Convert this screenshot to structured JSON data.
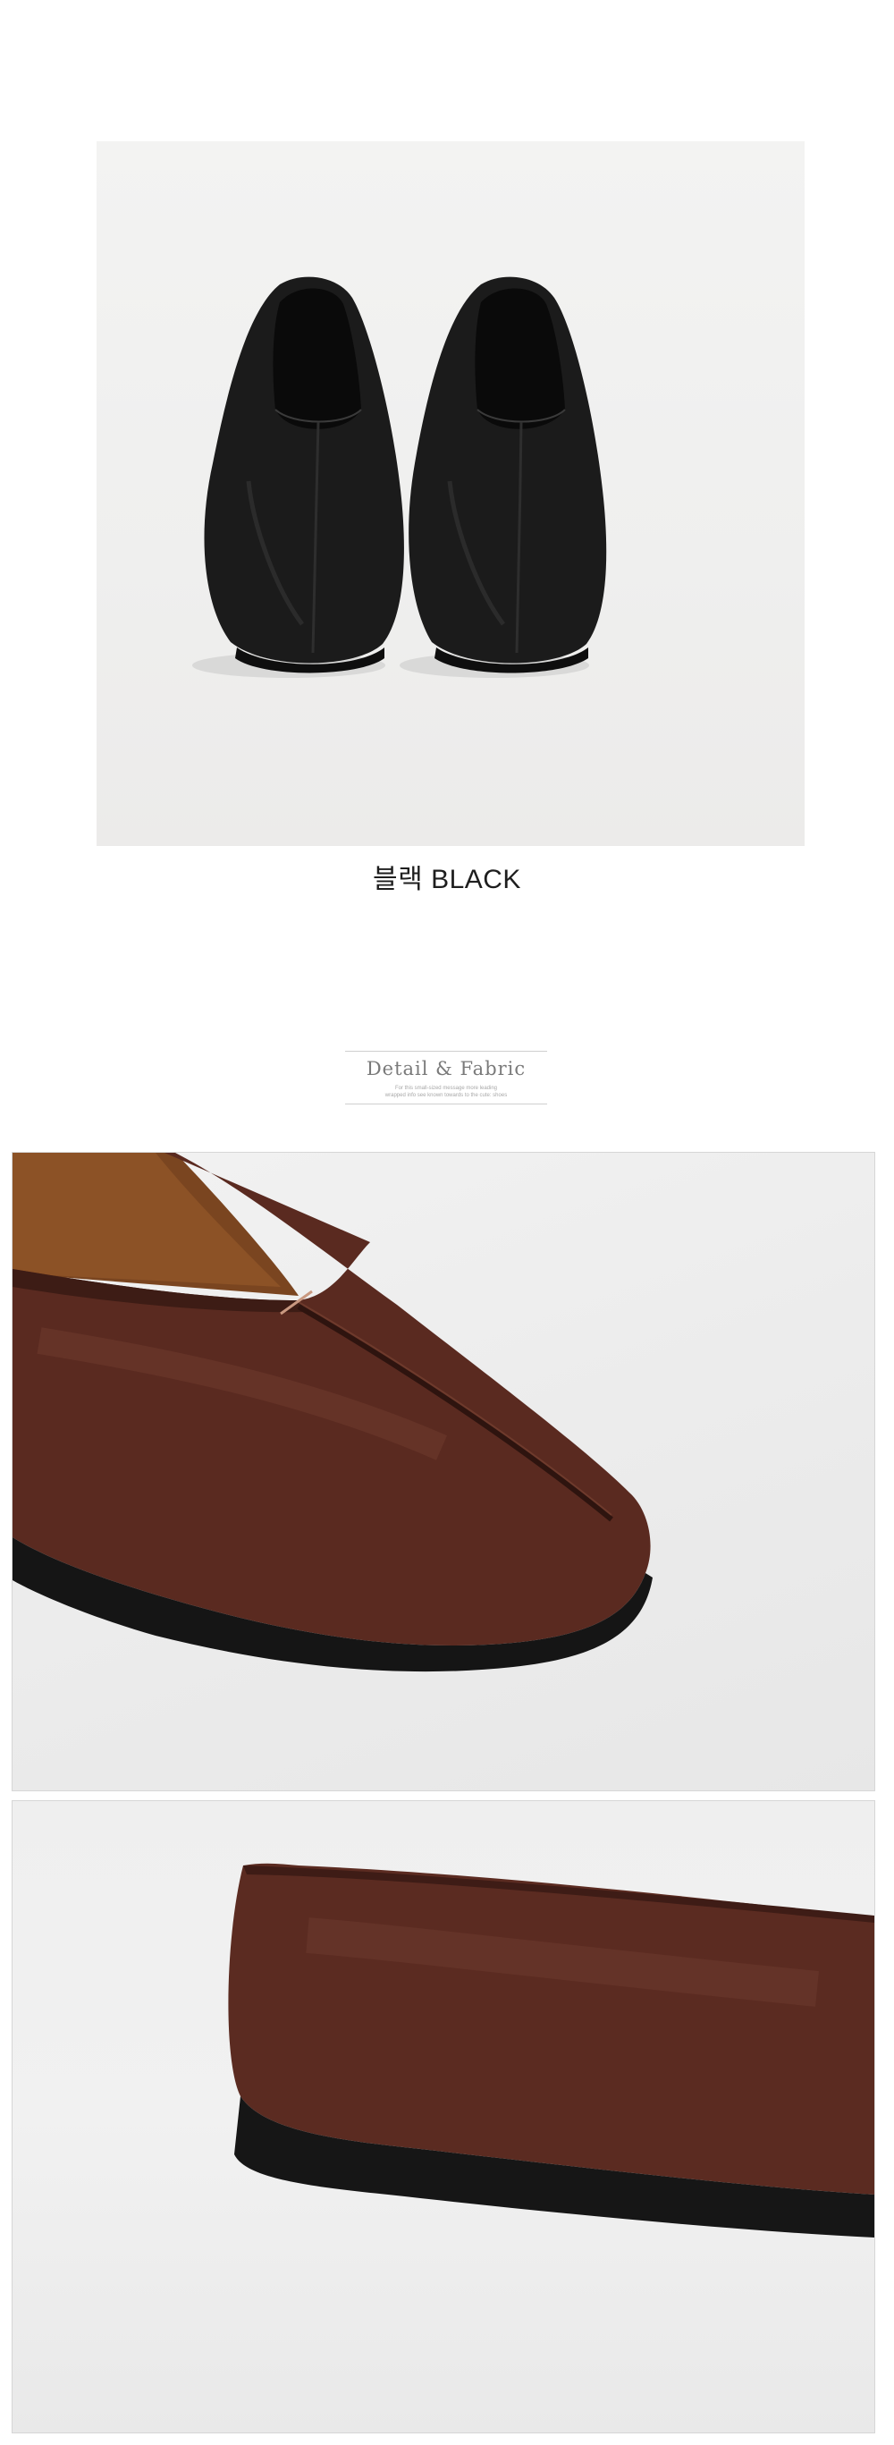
{
  "product_photo": {
    "caption": "블랙 BLACK",
    "color_name_ko": "블랙",
    "color_name_en": "BLACK",
    "shoe_color": "#1b1b1b"
  },
  "detail_label": {
    "title": "Detail & Fabric",
    "subtitle_line1": "For this small-sized message more leading",
    "subtitle_line2": "wrapped info see known towards to the cute: shoes"
  },
  "detail_photos": {
    "toe_color": "#5a2a20",
    "heel_color": "#5b2b21",
    "sole_color": "#1a1a1a"
  }
}
